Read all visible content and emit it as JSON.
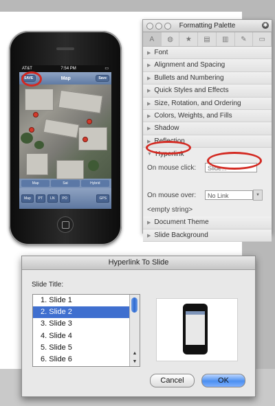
{
  "phone": {
    "carrier": "AT&T",
    "time": "7:54 PM",
    "nav_left": "SAVE",
    "nav_title": "Map",
    "nav_right": "Save",
    "segments": [
      "Map",
      "Sat",
      "Hybrid"
    ],
    "toolbar": [
      "Map",
      "PT",
      "LN",
      "PO",
      "GPS"
    ]
  },
  "palette": {
    "title": "Formatting Palette",
    "sections_top": [
      "Font",
      "Alignment and Spacing",
      "Bullets and Numbering",
      "Quick Styles and Effects",
      "Size, Rotation, and Ordering",
      "Colors, Weights, and Fills",
      "Shadow",
      "Reflection"
    ],
    "hyperlink": {
      "title": "Hyperlink",
      "click_label": "On mouse click:",
      "click_value": "Slide...",
      "over_label": "On mouse over:",
      "over_value": "No Link",
      "empty": "<empty string>"
    },
    "sections_bottom": [
      "Document Theme",
      "Slide Background"
    ]
  },
  "dialog": {
    "title": "Hyperlink To Slide",
    "label": "Slide Title:",
    "slides": [
      "1. Slide 1",
      "2. Slide 2",
      "3. Slide 3",
      "4. Slide 4",
      "5. Slide 5",
      "6. Slide 6"
    ],
    "cancel": "Cancel",
    "ok": "OK"
  }
}
